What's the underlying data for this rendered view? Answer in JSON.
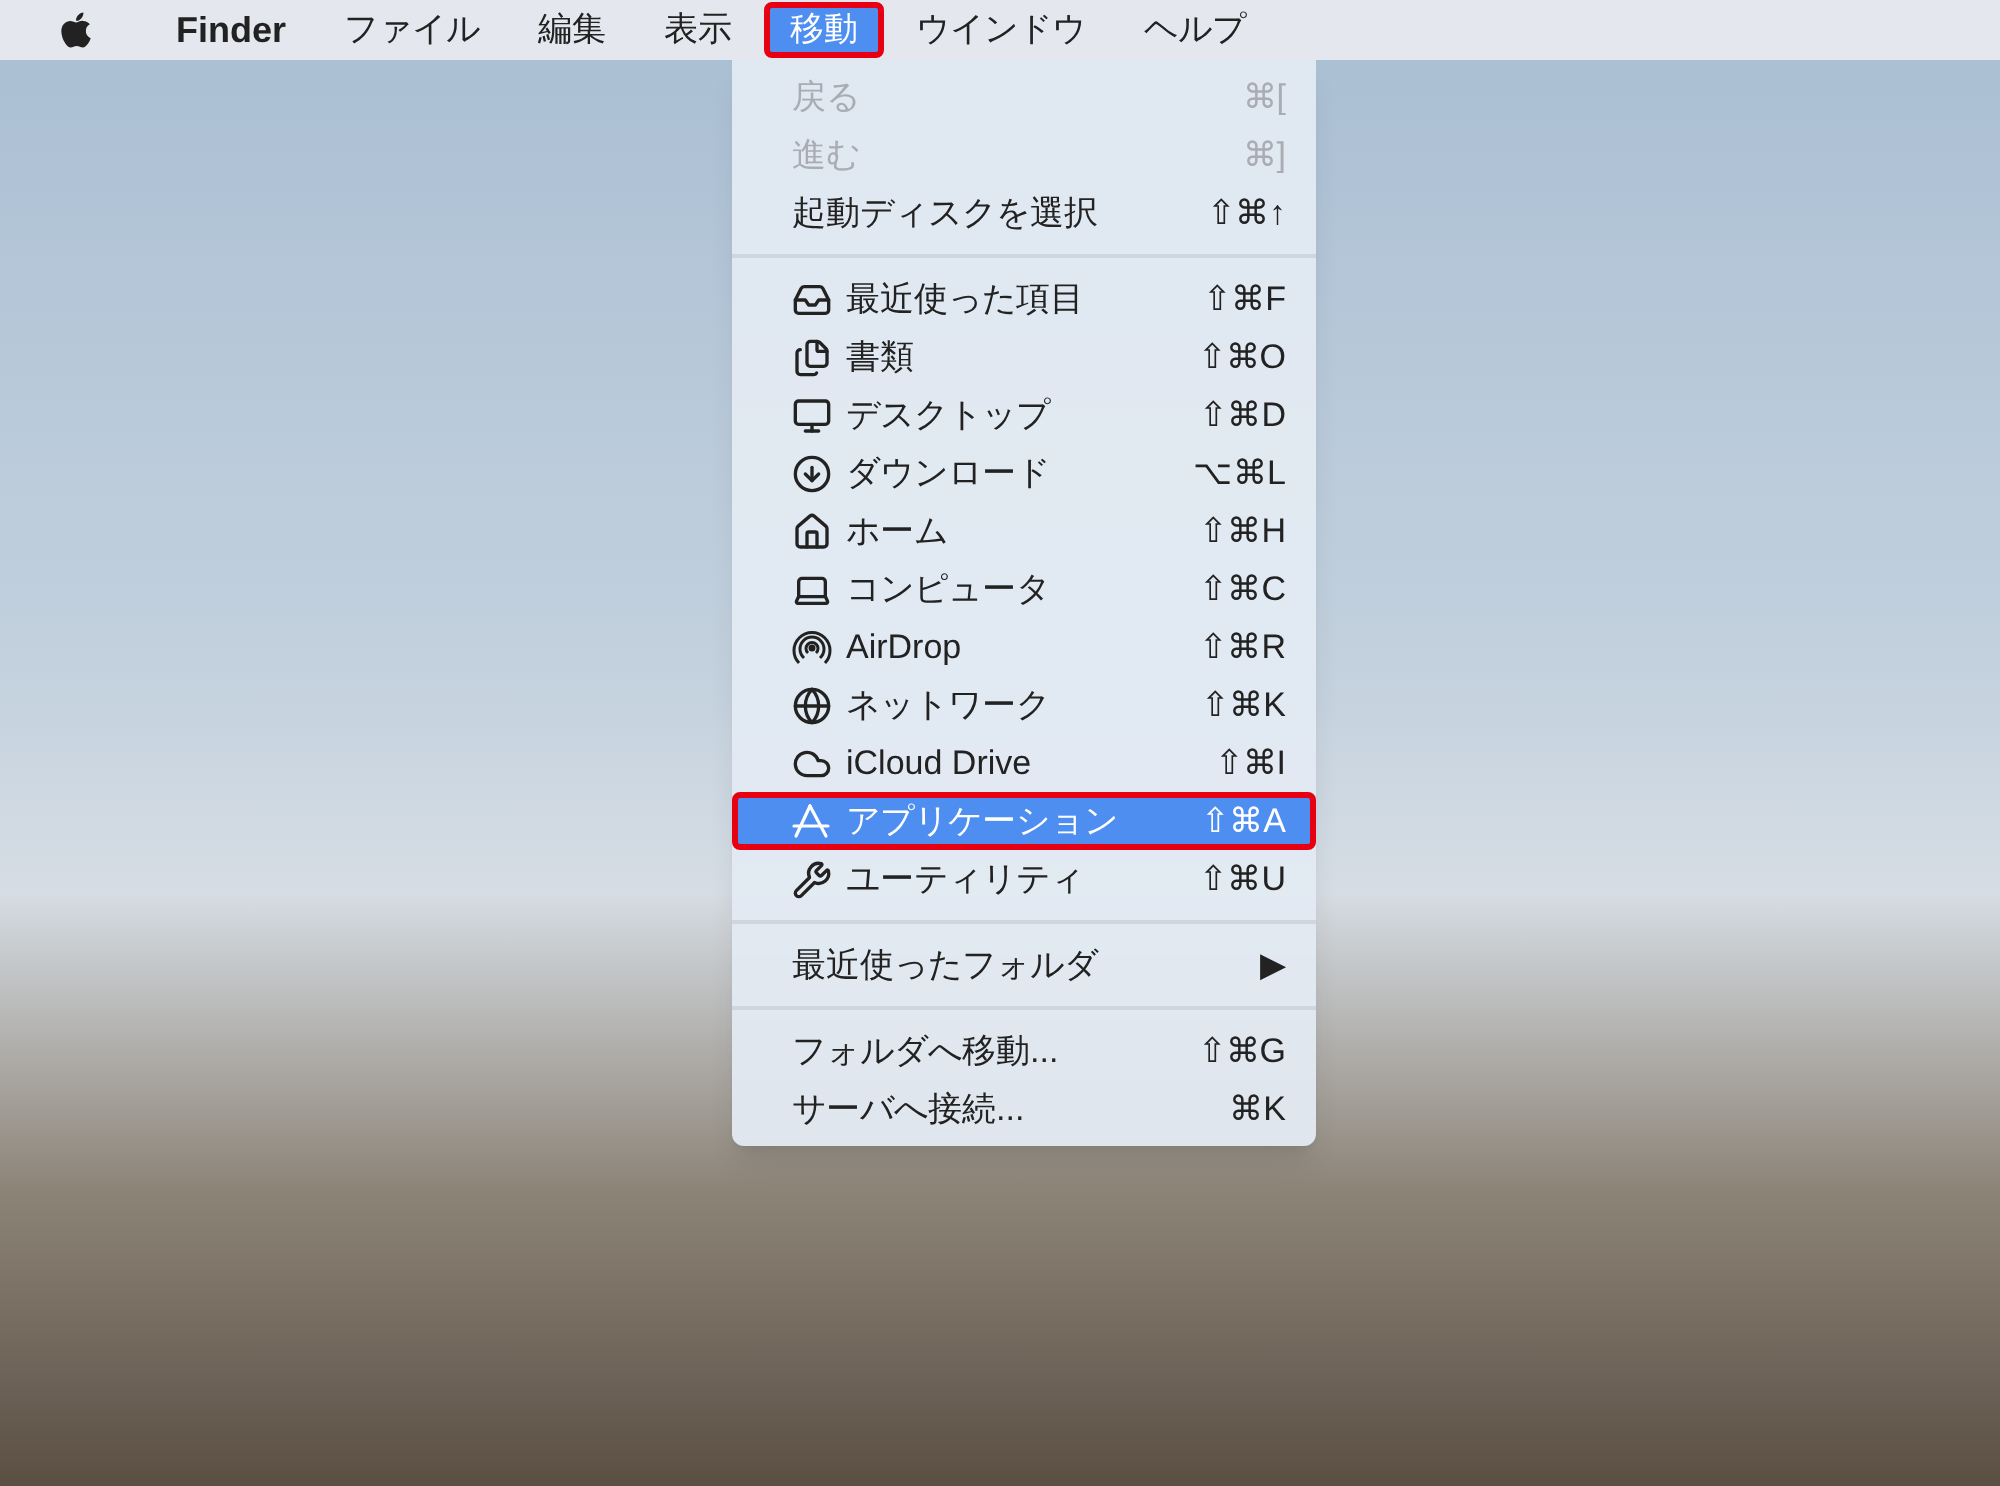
{
  "menu_bar": {
    "items": [
      {
        "label": "Finder",
        "selected": false
      },
      {
        "label": "ファイル",
        "selected": false
      },
      {
        "label": "編集",
        "selected": false
      },
      {
        "label": "表示",
        "selected": false
      },
      {
        "label": "移動",
        "selected": true
      },
      {
        "label": "ウインドウ",
        "selected": false
      },
      {
        "label": "ヘルプ",
        "selected": false
      }
    ]
  },
  "menu": {
    "groups": [
      {
        "items": [
          {
            "label": "戻る",
            "shortcut": "⌘[",
            "disabled": true,
            "selected": false
          },
          {
            "label": "進む",
            "shortcut": "⌘]",
            "disabled": true,
            "selected": false
          },
          {
            "label": "起動ディスクを選択",
            "shortcut": "⇧⌘↑",
            "disabled": false,
            "selected": false
          }
        ]
      },
      {
        "items": [
          {
            "label": "最近使った項目",
            "shortcut": "⇧⌘F",
            "disabled": false,
            "selected": false
          },
          {
            "label": "書類",
            "shortcut": "⇧⌘O",
            "disabled": false,
            "selected": false
          },
          {
            "label": "デスクトップ",
            "shortcut": "⇧⌘D",
            "disabled": false,
            "selected": false
          },
          {
            "label": "ダウンロード",
            "shortcut": "⌥⌘L",
            "disabled": false,
            "selected": false
          },
          {
            "label": "ホーム",
            "shortcut": "⇧⌘H",
            "disabled": false,
            "selected": false
          },
          {
            "label": "コンピュータ",
            "shortcut": "⇧⌘C",
            "disabled": false,
            "selected": false
          },
          {
            "label": "AirDrop",
            "shortcut": "⇧⌘R",
            "disabled": false,
            "selected": false
          },
          {
            "label": "ネットワーク",
            "shortcut": "⇧⌘K",
            "disabled": false,
            "selected": false
          },
          {
            "label": "iCloud Drive",
            "shortcut": "⇧⌘I",
            "disabled": false,
            "selected": false
          },
          {
            "label": "アプリケーション",
            "shortcut": "⇧⌘A",
            "disabled": false,
            "selected": true
          },
          {
            "label": "ユーティリティ",
            "shortcut": "⇧⌘U",
            "disabled": false,
            "selected": false
          }
        ]
      },
      {
        "items": [
          {
            "label": "最近使ったフォルダ",
            "shortcut": "▶",
            "disabled": false,
            "selected": false
          }
        ]
      },
      {
        "items": [
          {
            "label": "フォルダへ移動...",
            "shortcut": "⇧⌘G",
            "disabled": false,
            "selected": false
          },
          {
            "label": "サーバへ接続...",
            "shortcut": "⌘K",
            "disabled": false,
            "selected": false
          }
        ]
      }
    ]
  }
}
